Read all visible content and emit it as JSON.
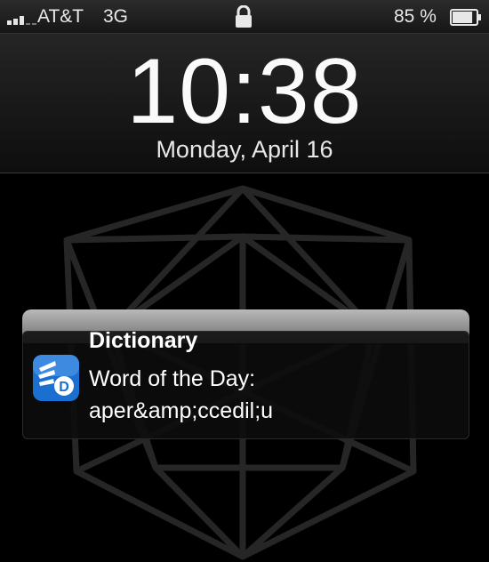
{
  "status_bar": {
    "carrier": "AT&T",
    "network": "3G",
    "battery_percent": "85 %",
    "battery_level": 0.85
  },
  "lock_screen": {
    "time": "10:38",
    "date": "Monday, April 16"
  },
  "notification": {
    "app_name": "Dictionary",
    "line1": "Word of the Day:",
    "line2": "aper&amp;ccedil;u",
    "icon": "dictionary-app-icon"
  },
  "colors": {
    "app_icon_blue": "#1a6fd0",
    "background": "#000000"
  }
}
